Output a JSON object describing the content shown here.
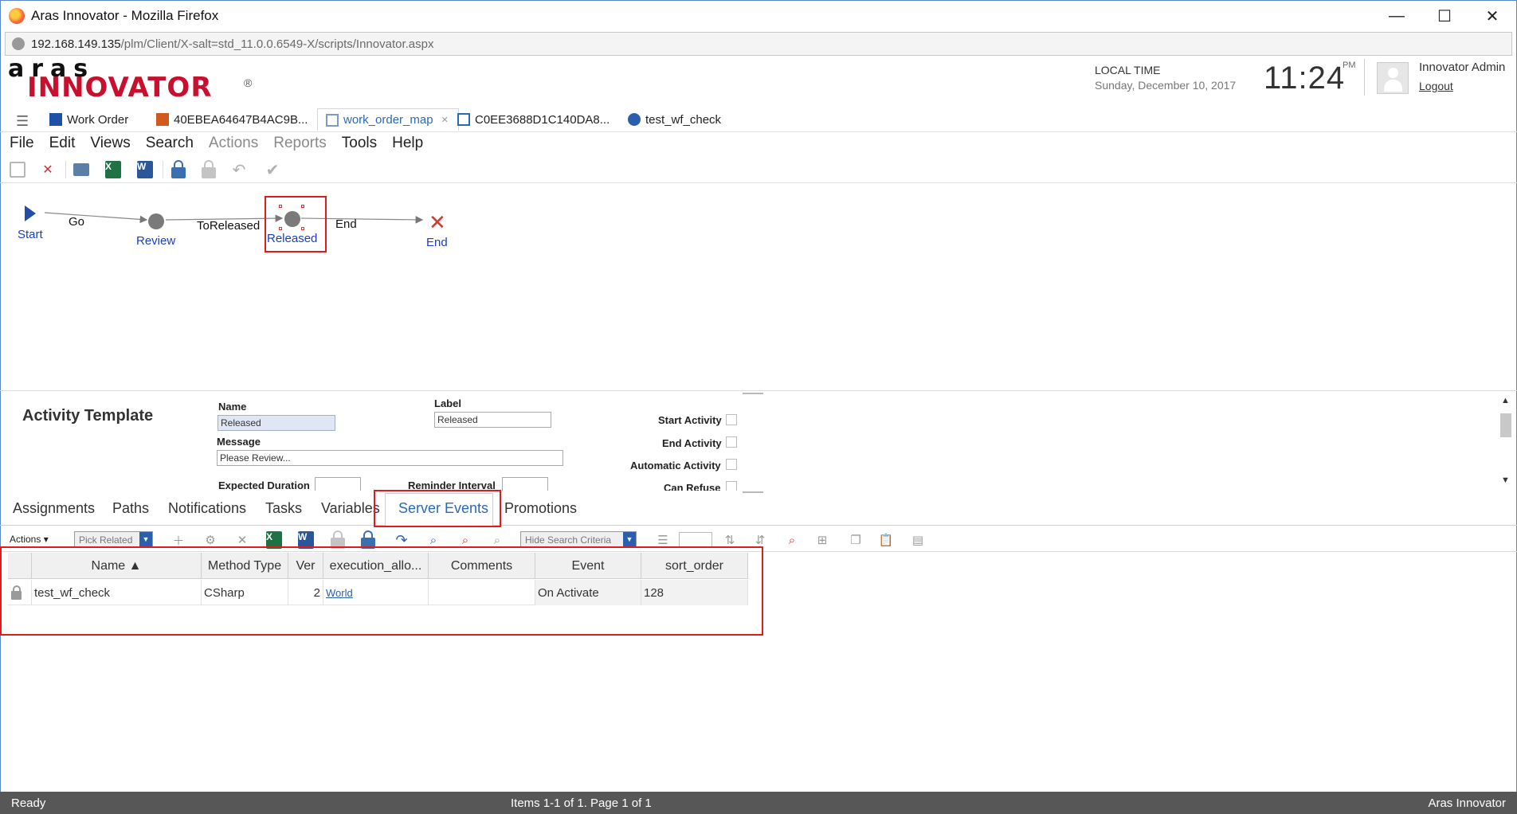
{
  "window": {
    "title": "Aras Innovator - Mozilla Firefox",
    "minimize": "—",
    "maximize": "☐",
    "close": "✕"
  },
  "url": {
    "host": "192.168.149.135",
    "path": "/plm/Client/X-salt=std_11.0.0.6549-X/scripts/Innovator.aspx"
  },
  "logo": {
    "top": "aras",
    "main": "INNOVATOR",
    "reg": "®"
  },
  "header": {
    "local_time_label": "LOCAL TIME",
    "date": "Sunday, December 10, 2017",
    "time": "11:24",
    "ampm": "PM",
    "user": "Innovator Admin",
    "logout": "Logout"
  },
  "tabs": [
    {
      "label": "Work Order"
    },
    {
      "label": "40EBEA64647B4AC9B..."
    },
    {
      "label": "work_order_map"
    },
    {
      "label": "C0EE3688D1C140DA8..."
    },
    {
      "label": "test_wf_check"
    }
  ],
  "menu": [
    "File",
    "Edit",
    "Views",
    "Search",
    "Actions",
    "Reports",
    "Tools",
    "Help"
  ],
  "workflow": {
    "nodes": {
      "start": "Start",
      "review": "Review",
      "released": "Released",
      "end": "End"
    },
    "paths": {
      "go": "Go",
      "to_released": "ToReleased",
      "end": "End"
    }
  },
  "form": {
    "title": "Activity Template",
    "name_label": "Name",
    "name_value": "Released",
    "label_label": "Label",
    "label_value": "Released",
    "message_label": "Message",
    "message_value": "Please Review...",
    "expected_duration_label": "Expected Duration",
    "reminder_interval_label": "Reminder Interval",
    "start_activity_label": "Start Activity",
    "end_activity_label": "End Activity",
    "automatic_activity_label": "Automatic Activity",
    "can_refuse_label": "Can Refuse"
  },
  "relationship_tabs": [
    "Assignments",
    "Paths",
    "Notifications",
    "Tasks",
    "Variables",
    "Server Events",
    "Promotions"
  ],
  "grid_toolbar": {
    "actions": "Actions",
    "pick_related": "Pick Related",
    "hide_search": "Hide Search Criteria"
  },
  "grid": {
    "columns": [
      "Name ▲",
      "Method Type",
      "Ver",
      "execution_allo...",
      "Comments",
      "Event",
      "sort_order"
    ],
    "rows": [
      [
        "test_wf_check",
        "CSharp",
        "2",
        "World",
        "",
        "On Activate",
        "128"
      ]
    ]
  },
  "status": {
    "left": "Ready",
    "middle": "Items 1-1 of 1. Page 1 of 1",
    "right": "Aras Innovator"
  },
  "colors": {
    "accent": "#2a6ab8",
    "highlight": "#e01b1b",
    "brand_red": "#c8102e",
    "status_bar": "#575757"
  }
}
